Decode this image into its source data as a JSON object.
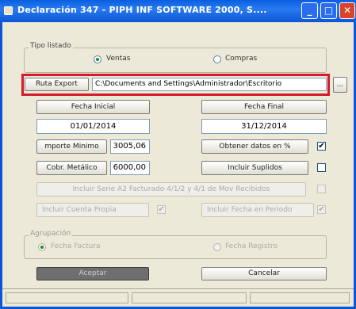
{
  "window": {
    "title": "Declaración 347 - PIPH INF SOFTWARE 2000, S...."
  },
  "tipo_listado": {
    "legend": "Tipo listado",
    "ventas_label": "Ventas",
    "compras_label": "Compras",
    "selected": "Ventas"
  },
  "ruta": {
    "label": "Ruta Export",
    "value": "C:\\Documents and Settings\\Administrador\\Escritorio",
    "browse_label": "..."
  },
  "fechas": {
    "inicial_label": "Fecha Inicial",
    "inicial_value": "01/01/2014",
    "final_label": "Fecha Final",
    "final_value": "31/12/2014"
  },
  "importe": {
    "label": "mporte Minimo",
    "value": "3005,06"
  },
  "obtener": {
    "label": "Obtener datos en %",
    "checked": true
  },
  "cobr": {
    "label": "Cobr. Metálico",
    "value": "6000,00"
  },
  "incluir_suplidos": {
    "label": "Incluir Suplidos",
    "checked": false
  },
  "row_incluir_serie": {
    "label": "Incluir Serie A2 Facturado 4/1/2 y 4/1 de Mov Recibidos",
    "checked": false
  },
  "row_incluir_cuenta": {
    "label": "Incluir Cuenta Propia",
    "checked": true
  },
  "row_incluir_fecha": {
    "label": "Incluir Fecha en Periodo",
    "checked": true
  },
  "agrupacion": {
    "legend": "Agrupación",
    "fecha_factura_label": "Fecha Factura",
    "fecha_registro_label": "Fecha Registro",
    "selected": "Fecha Factura"
  },
  "actions": {
    "aceptar_label": "Aceptar",
    "cancelar_label": "Cancelar"
  },
  "colors": {
    "title_bar": "#0a5fe0",
    "highlight": "#d51b2a",
    "window_bg": "#ece9d8"
  }
}
